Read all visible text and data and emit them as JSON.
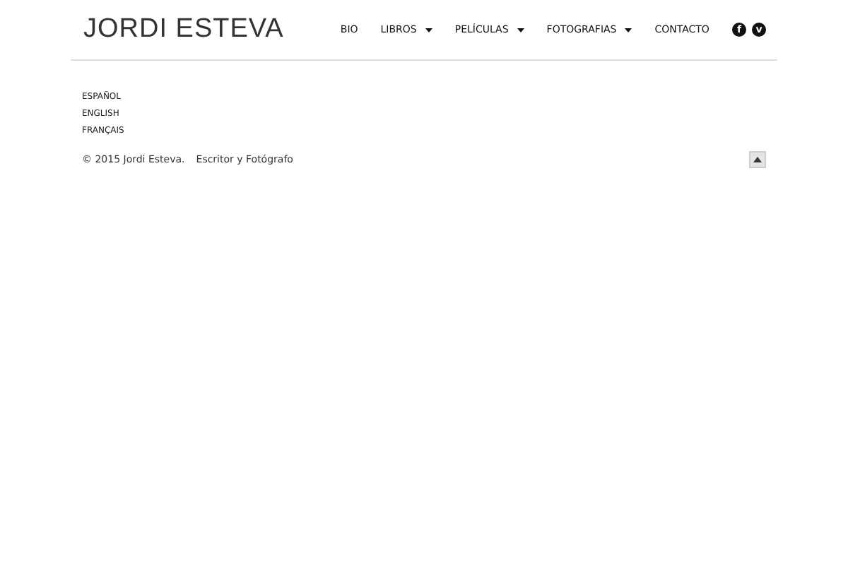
{
  "header": {
    "logo": "JORDI ESTEVA",
    "nav": [
      {
        "label": "BIO",
        "dropdown": false
      },
      {
        "label": "LIBROS",
        "dropdown": true
      },
      {
        "label": "PELÍCULAS",
        "dropdown": true
      },
      {
        "label": "FOTOGRAFIAS",
        "dropdown": true
      },
      {
        "label": "CONTACTO",
        "dropdown": false
      }
    ],
    "social": [
      {
        "glyph": "f"
      },
      {
        "glyph": "v"
      }
    ]
  },
  "languages": [
    "ESPAÑOL",
    "ENGLISH",
    "FRANÇAIS"
  ],
  "footer": {
    "copyright": "© 2015 Jordi Esteva.",
    "tagline": "Escritor y Fotógrafo"
  }
}
